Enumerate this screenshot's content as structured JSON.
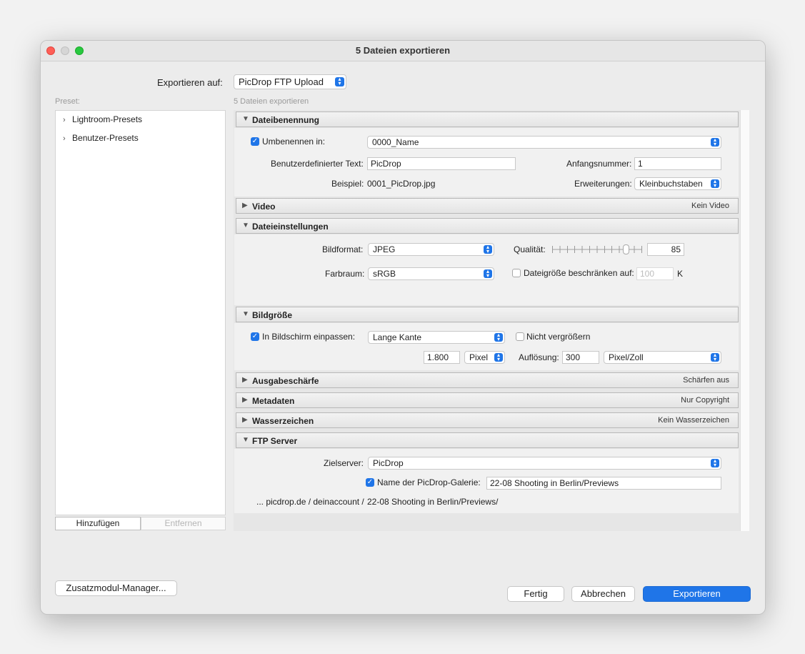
{
  "window": {
    "title": "5 Dateien exportieren"
  },
  "export_to": {
    "label": "Exportieren auf:",
    "value": "PicDrop FTP Upload"
  },
  "preset": {
    "label": "Preset:",
    "items": [
      {
        "label": "Lightroom-Presets"
      },
      {
        "label": "Benutzer-Presets"
      }
    ],
    "add_label": "Hinzufügen",
    "remove_label": "Entfernen"
  },
  "main": {
    "caption": "5 Dateien exportieren"
  },
  "file_naming": {
    "title": "Dateibenennung",
    "rename_label": "Umbenennen in:",
    "rename_value": "0000_Name",
    "custom_text_label": "Benutzerdefinierter Text:",
    "custom_text_value": "PicDrop",
    "start_number_label": "Anfangsnummer:",
    "start_number_value": "1",
    "example_label": "Beispiel:",
    "example_value": "0001_PicDrop.jpg",
    "extensions_label": "Erweiterungen:",
    "extensions_value": "Kleinbuchstaben"
  },
  "video": {
    "title": "Video",
    "summary": "Kein Video"
  },
  "file_settings": {
    "title": "Dateieinstellungen",
    "format_label": "Bildformat:",
    "format_value": "JPEG",
    "quality_label": "Qualität:",
    "quality_value": "85",
    "quality_fraction": 0.85,
    "colorspace_label": "Farbraum:",
    "colorspace_value": "sRGB",
    "limit_label": "Dateigröße beschränken auf:",
    "limit_value": "100",
    "limit_unit": "K"
  },
  "image_size": {
    "title": "Bildgröße",
    "fit_label": "In Bildschirm einpassen:",
    "fit_value": "Lange Kante",
    "no_enlarge_label": "Nicht vergrößern",
    "size_value": "1.800",
    "size_unit": "Pixel",
    "resolution_label": "Auflösung:",
    "resolution_value": "300",
    "resolution_unit": "Pixel/Zoll"
  },
  "sharpening": {
    "title": "Ausgabeschärfe",
    "summary": "Schärfen aus"
  },
  "metadata": {
    "title": "Metadaten",
    "summary": "Nur Copyright"
  },
  "watermark": {
    "title": "Wasserzeichen",
    "summary": "Kein Wasserzeichen"
  },
  "ftp": {
    "title": "FTP Server",
    "target_label": "Zielserver:",
    "target_value": "PicDrop",
    "gallery_label": "Name der PicDrop-Galerie:",
    "gallery_value": "22-08 Shooting in Berlin/Previews",
    "path_prefix": "... picdrop.de / deinaccount /",
    "path_value": "22-08 Shooting in Berlin/Previews/"
  },
  "footer": {
    "plugin_manager_label": "Zusatzmodul-Manager...",
    "done_label": "Fertig",
    "cancel_label": "Abbrechen",
    "export_label": "Exportieren"
  },
  "colors": {
    "accent": "#1f75e8"
  }
}
